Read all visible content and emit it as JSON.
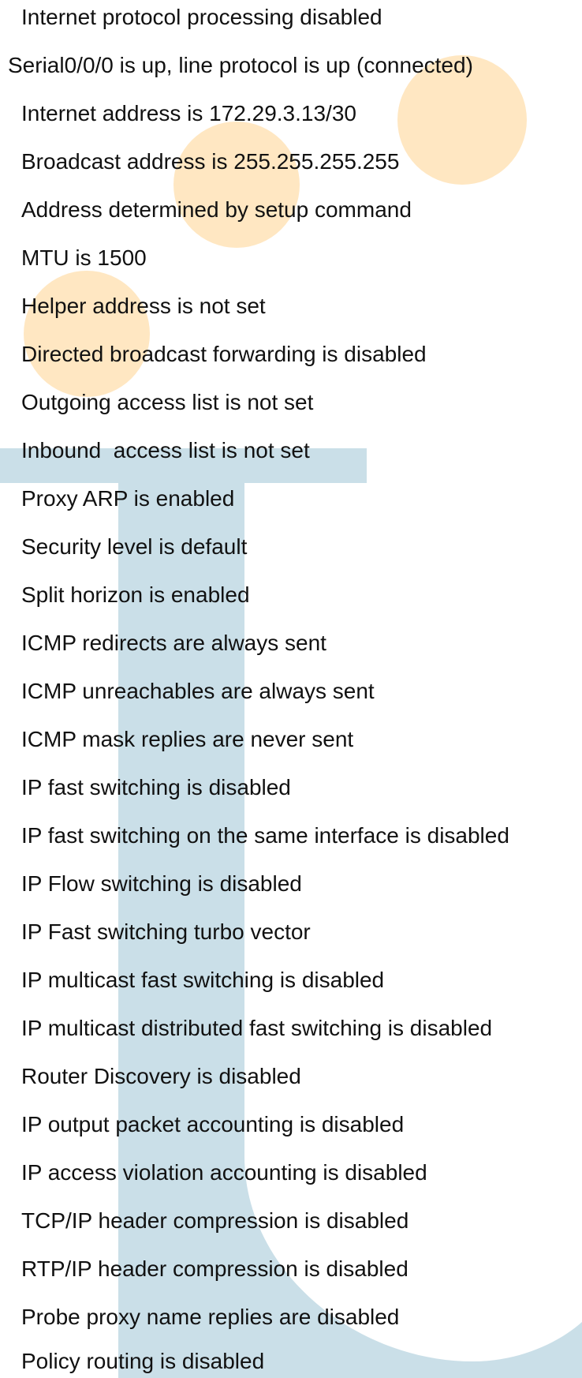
{
  "lines": [
    {
      "text": "Internet protocol processing disabled",
      "indent": 1
    },
    {
      "text": "Serial0/0/0 is up, line protocol is up (connected)",
      "indent": 0
    },
    {
      "text": "Internet address is 172.29.3.13/30",
      "indent": 1
    },
    {
      "text": "Broadcast address is 255.255.255.255",
      "indent": 1
    },
    {
      "text": "Address determined by setup command",
      "indent": 1
    },
    {
      "text": "MTU is 1500",
      "indent": 1
    },
    {
      "text": "Helper address is not set",
      "indent": 1
    },
    {
      "text": "Directed broadcast forwarding is disabled",
      "indent": 1
    },
    {
      "text": "Outgoing access list is not set",
      "indent": 1
    },
    {
      "text": "Inbound  access list is not set",
      "indent": 1
    },
    {
      "text": "Proxy ARP is enabled",
      "indent": 1
    },
    {
      "text": "Security level is default",
      "indent": 1
    },
    {
      "text": "Split horizon is enabled",
      "indent": 1
    },
    {
      "text": "ICMP redirects are always sent",
      "indent": 1
    },
    {
      "text": "ICMP unreachables are always sent",
      "indent": 1
    },
    {
      "text": "ICMP mask replies are never sent",
      "indent": 1
    },
    {
      "text": "IP fast switching is disabled",
      "indent": 1
    },
    {
      "text": "IP fast switching on the same interface is disabled",
      "indent": 1
    },
    {
      "text": "IP Flow switching is disabled",
      "indent": 1
    },
    {
      "text": "IP Fast switching turbo vector",
      "indent": 1
    },
    {
      "text": "IP multicast fast switching is disabled",
      "indent": 1
    },
    {
      "text": "IP multicast distributed fast switching is disabled",
      "indent": 1
    },
    {
      "text": "Router Discovery is disabled",
      "indent": 1
    },
    {
      "text": "IP output packet accounting is disabled",
      "indent": 1
    },
    {
      "text": "IP access violation accounting is disabled",
      "indent": 1
    },
    {
      "text": "TCP/IP header compression is disabled",
      "indent": 1
    },
    {
      "text": "RTP/IP header compression is disabled",
      "indent": 1
    },
    {
      "text": "Probe proxy name replies are disabled",
      "indent": 1
    },
    {
      "text": "Policy routing is disabled",
      "indent": 1
    }
  ],
  "colors": {
    "text": "#111111",
    "orange_circles": "#FFE7C2",
    "blue_shape": "#CADFE8",
    "background": "#FFFFFF"
  }
}
